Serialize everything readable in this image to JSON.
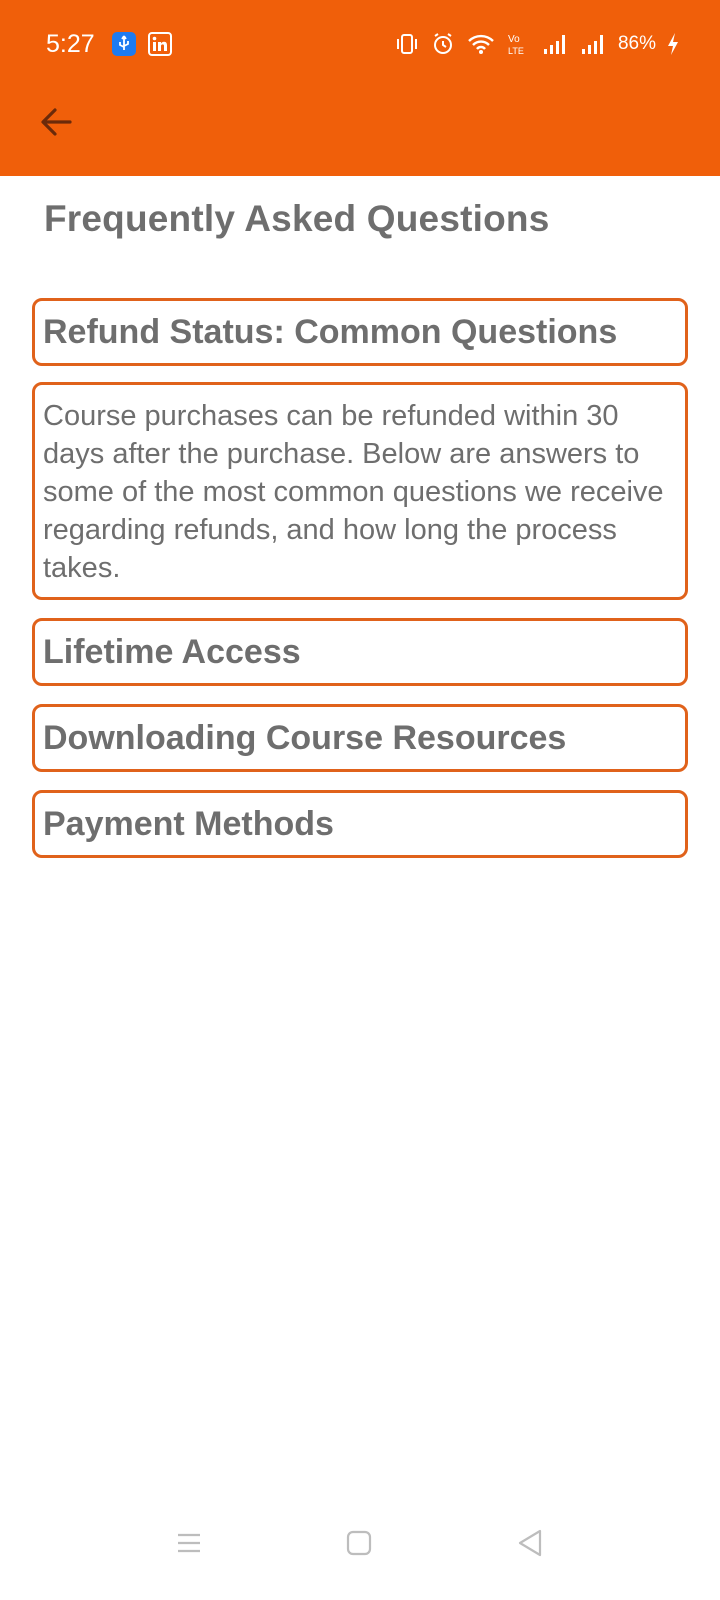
{
  "status_bar": {
    "time": "5:27",
    "battery": "86%",
    "icons": [
      "usb-icon",
      "linkedin-icon",
      "vibrate-icon",
      "alarm-icon",
      "wifi-icon",
      "volte-icon",
      "signal-icon",
      "signal-icon",
      "charging-icon"
    ]
  },
  "app_bar": {
    "back_icon": "arrow-left-icon",
    "color": "#F05F0A"
  },
  "page": {
    "title": "Frequently Asked Questions"
  },
  "faq": {
    "items": [
      {
        "question": "Refund Status: Common Questions",
        "answer": "Course purchases can be refunded within 30 days after the purchase. Below are answers to some of the most common questions we receive regarding refunds, and how long the process takes."
      },
      {
        "question": "Lifetime Access"
      },
      {
        "question": "Downloading Course Resources"
      },
      {
        "question": "Payment Methods"
      }
    ],
    "border_color": "#E0621B",
    "text_color": "#6E6E6E"
  },
  "nav_bar": {
    "icons": [
      "menu-icon",
      "home-icon",
      "back-triangle-icon"
    ]
  }
}
